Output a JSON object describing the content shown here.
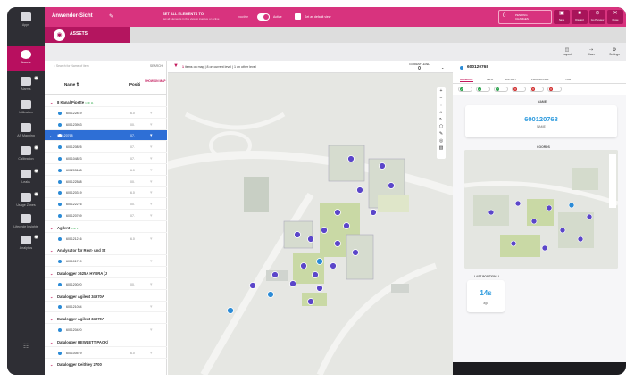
{
  "rail": {
    "items": [
      {
        "label": "Apps"
      },
      {
        "label": "Assets"
      },
      {
        "label": "Alarms"
      },
      {
        "label": "Utilization"
      },
      {
        "label": "AS Mapping"
      },
      {
        "label": "Calibration"
      },
      {
        "label": "Leaks"
      },
      {
        "label": "Usage Zones"
      },
      {
        "label": "Lifecycle Insights"
      },
      {
        "label": "Analytics"
      }
    ]
  },
  "topbar": {
    "title": "Anwender-Sicht",
    "set_all": "SET ALL ELEMENTS TO",
    "set_all_sub": "Set all elements in this view to inactive or active",
    "inactive": "Inactive",
    "active": "Active",
    "set_default": "Set as default view",
    "pending_count": "0",
    "pending_label1": "PENDING",
    "pending_label2": "CHANGES",
    "buttons": [
      {
        "icon": "save-icon",
        "glyph": "▣",
        "label": "Save"
      },
      {
        "icon": "discard-icon",
        "glyph": "■",
        "label": "Discard"
      },
      {
        "icon": "preview-icon",
        "glyph": "⊙",
        "label": "Go Preview"
      },
      {
        "icon": "close-icon",
        "glyph": "✕",
        "label": "Close"
      }
    ]
  },
  "assetbar": {
    "label": "ASSETS"
  },
  "subbar": {
    "buttons": [
      {
        "icon": "layout-icon",
        "glyph": "◫",
        "label": "Layout"
      },
      {
        "icon": "share-icon",
        "glyph": "⇢",
        "label": "Share"
      },
      {
        "icon": "settings-icon",
        "glyph": "⚙",
        "label": "Settings"
      }
    ]
  },
  "list": {
    "search_placeholder": "Search for Name of item",
    "search_button": "SEARCH",
    "col_name": "Name",
    "col_pos": "Positi",
    "col_show": "SHOW ON MAP",
    "rows": [
      {
        "type": "grp",
        "text": "8 Kanal Pipette",
        "badge": "1 OF 11"
      },
      {
        "type": "sub",
        "text": "600122819",
        "pv": "6.0"
      },
      {
        "type": "sub",
        "text": "600123953",
        "pv": "00."
      },
      {
        "type": "sel",
        "text": "600120768",
        "pv": "07."
      },
      {
        "type": "sub",
        "text": "600120825",
        "pv": "07."
      },
      {
        "type": "sub",
        "text": "600104823",
        "pv": "07."
      },
      {
        "type": "sub",
        "text": "600203188",
        "pv": "6.0"
      },
      {
        "type": "sub",
        "text": "600122588",
        "pv": "00."
      },
      {
        "type": "sub",
        "text": "600120319",
        "pv": "6.0"
      },
      {
        "type": "sub",
        "text": "600122276",
        "pv": "00."
      },
      {
        "type": "sub",
        "text": "600120769",
        "pv": "07."
      },
      {
        "type": "grp",
        "text": "Agilent",
        "badge": "1 OF 1"
      },
      {
        "type": "sub",
        "text": "600121216",
        "pv": "6.0"
      },
      {
        "type": "grp",
        "text": "Analysator für Rest- und St",
        "badge": ""
      },
      {
        "type": "sub",
        "text": "600101719",
        "pv": ""
      },
      {
        "type": "grp",
        "text": "Datalogger 3625A HYDRA (J",
        "badge": ""
      },
      {
        "type": "sub",
        "text": "600120020",
        "pv": "00."
      },
      {
        "type": "grp",
        "text": "Datalogger Agilent 34970A",
        "badge": ""
      },
      {
        "type": "sub",
        "text": "600121054",
        "pv": ""
      },
      {
        "type": "grp",
        "text": "Datalogger Agilent 34970A",
        "badge": ""
      },
      {
        "type": "sub",
        "text": "600120420",
        "pv": ""
      },
      {
        "type": "grp",
        "text": "Datalogger HEWLETT PACK/",
        "badge": ""
      },
      {
        "type": "sub",
        "text": "600100579",
        "pv": "6.0"
      },
      {
        "type": "grp",
        "text": "Datalogger Keithley 2700",
        "badge": ""
      }
    ]
  },
  "map": {
    "items_on_map": "1",
    "summary": "items on map | 8 on current level | 1 on other level",
    "level_label": "CURRENT LEVEL",
    "level_value": "0"
  },
  "right": {
    "asset_id": "600120768",
    "tabs": [
      "GENERAL",
      "INFO",
      "HISTORY",
      "PROPERTIES",
      "TAG"
    ],
    "name_label": "NAME",
    "name_value": "600120768",
    "name_sub": "NAME",
    "coords_label": "COORDS",
    "last_label": "LAST POSITION U...",
    "last_value": "14s",
    "last_sub": "ago"
  },
  "colors": {
    "accent": "#d8337e",
    "accent_dark": "#b4155f",
    "selected": "#2e6fd6",
    "value_blue": "#2e9bde"
  }
}
